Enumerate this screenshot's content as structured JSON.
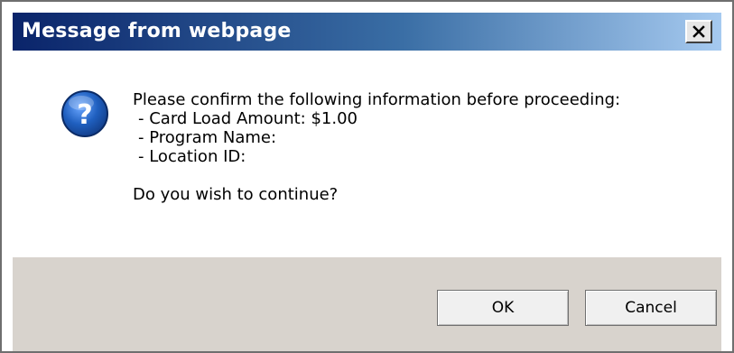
{
  "window": {
    "title": "Message from webpage",
    "close_icon": "close-icon"
  },
  "message": {
    "icon": "question-icon",
    "intro": "Please confirm the following information before proceeding:",
    "items": [
      " - Card Load Amount: $1.00",
      " - Program Name:",
      " - Location ID:"
    ],
    "question": "Do you wish to continue?"
  },
  "buttons": {
    "ok_label": "OK",
    "cancel_label": "Cancel"
  },
  "colors": {
    "title_gradient_start": "#0a246a",
    "title_gradient_end": "#a6caf0",
    "footer_bg": "#d8d3cd",
    "icon_blue": "#1f5fbf"
  }
}
